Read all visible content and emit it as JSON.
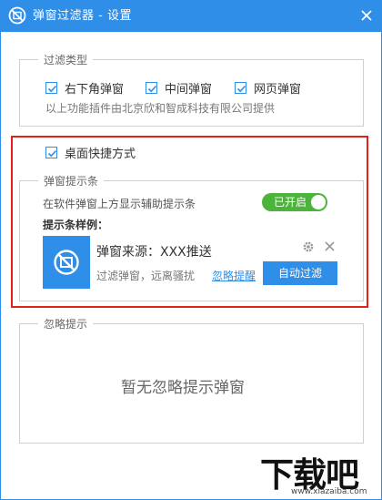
{
  "window": {
    "title": "弹窗过滤器 - 设置"
  },
  "filter_types": {
    "legend": "过滤类型",
    "options": [
      {
        "label": "右下角弹窗",
        "checked": true
      },
      {
        "label": "中间弹窗",
        "checked": true
      },
      {
        "label": "网页弹窗",
        "checked": true
      }
    ],
    "provider_text": "以上功能插件由北京欣和智成科技有限公司提供"
  },
  "desktop_shortcut": {
    "label": "桌面快捷方式",
    "checked": true
  },
  "tip_bar": {
    "legend": "弹窗提示条",
    "description": "在软件弹窗上方显示辅助提示条",
    "toggle_label": "已开启",
    "sample_label": "提示条样例：",
    "sample": {
      "source_text": "弹窗来源：XXX推送",
      "subtitle": "过滤弹窗，远离骚扰",
      "ignore_link": "忽略提醒",
      "auto_filter_button": "自动过滤"
    }
  },
  "ignore_tips": {
    "legend": "忽略提示",
    "empty_text": "暂无忽略提示弹窗"
  },
  "watermark": {
    "text": "下载吧",
    "url_text": "www.xiazaiba.com"
  },
  "colors": {
    "accent": "#2e8ee8",
    "highlight": "#e0221c",
    "toggle_on": "#4cb43a"
  }
}
